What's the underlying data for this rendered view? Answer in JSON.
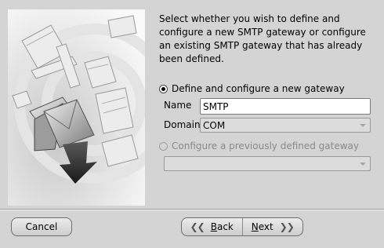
{
  "intro_text": "Select whether you wish to define and configure a new SMTP gateway or configure an existing SMTP gateway that has already been defined.",
  "options": {
    "new_gateway": {
      "label": "Define and configure a new gateway",
      "selected": true
    },
    "existing_gateway": {
      "label": "Configure a previously defined gateway",
      "selected": false,
      "enabled": false
    }
  },
  "form": {
    "name_label": "Name",
    "name_value": "SMTP",
    "domain_label": "Domain",
    "domain_value": "COM",
    "existing_gateway_value": ""
  },
  "buttons": {
    "cancel": "Cancel",
    "back_mnemonic": "B",
    "back_rest": "ack",
    "next_mnemonic": "N",
    "next_rest": "ext"
  },
  "icons": {
    "back": "double-chevron-left-icon",
    "next": "double-chevron-right-icon"
  }
}
